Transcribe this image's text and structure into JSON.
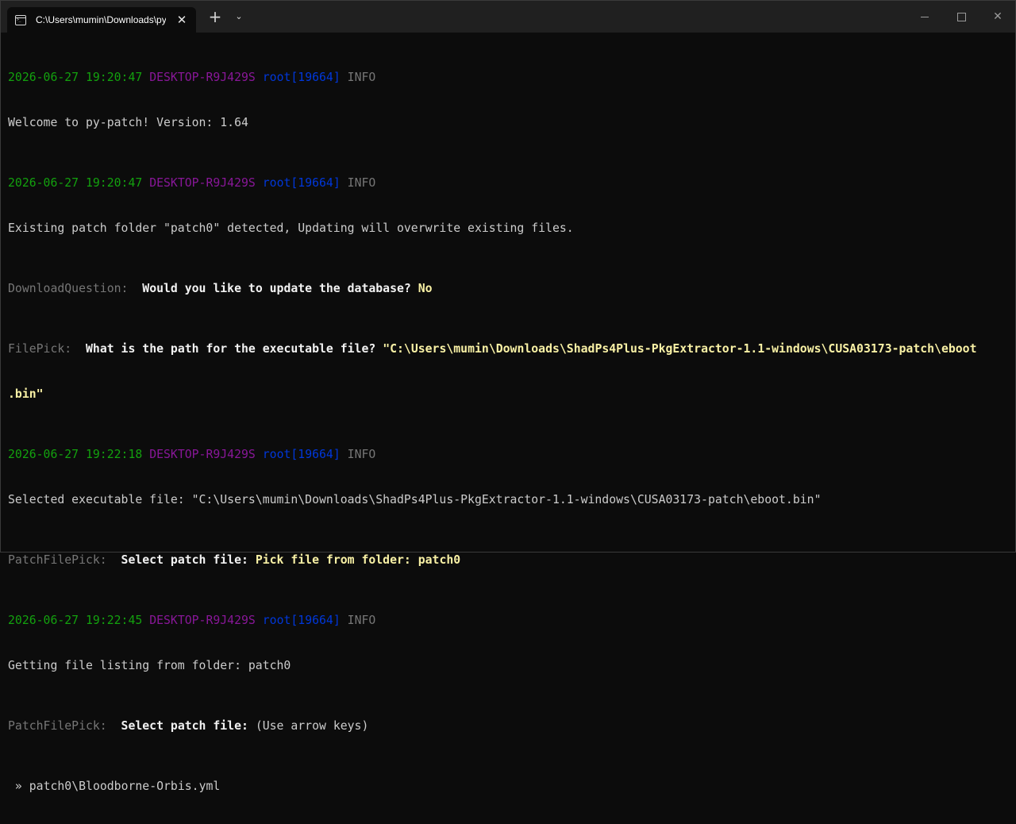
{
  "window": {
    "tab_title": "C:\\Users\\mumin\\Downloads\\py-patch.exe",
    "new_tab": "+",
    "dropdown": "⌄",
    "tab_close": "✕",
    "controls": {
      "close": "✕"
    }
  },
  "terminal": {
    "log1": {
      "date": "2026-06-27 19:20:47",
      "host": "DESKTOP-R9J429S",
      "user": "root[19664]",
      "level": "INFO"
    },
    "msg_welcome": "Welcome to py-patch! Version: 1.64",
    "log2": {
      "date": "2026-06-27 19:20:47",
      "host": "DESKTOP-R9J429S",
      "user": "root[19664]",
      "level": "INFO"
    },
    "msg_existing": "Existing patch folder \"patch0\" detected, Updating will overwrite existing files.",
    "q_download": {
      "tag": "DownloadQuestion:",
      "question": "Would you like to update the database?",
      "answer": "No"
    },
    "q_filepick": {
      "tag": "FilePick:",
      "question": "What is the path for the executable file?",
      "answer_line1": "\"C:\\Users\\mumin\\Downloads\\ShadPs4Plus-PkgExtractor-1.1-windows\\CUSA03173-patch\\eboot",
      "answer_line2": ".bin\""
    },
    "log3": {
      "date": "2026-06-27 19:22:18",
      "host": "DESKTOP-R9J429S",
      "user": "root[19664]",
      "level": "INFO"
    },
    "msg_selected": "Selected executable file: \"C:\\Users\\mumin\\Downloads\\ShadPs4Plus-PkgExtractor-1.1-windows\\CUSA03173-patch\\eboot.bin\"",
    "q_patchpick1": {
      "tag": "PatchFilePick:",
      "question": "Select patch file:",
      "answer": "Pick file from folder: patch0"
    },
    "log4": {
      "date": "2026-06-27 19:22:45",
      "host": "DESKTOP-R9J429S",
      "user": "root[19664]",
      "level": "INFO"
    },
    "msg_listing": "Getting file listing from folder: patch0",
    "q_patchpick2": {
      "tag": "PatchFilePick:",
      "question": "Select patch file:",
      "hint": "(Use arrow keys)"
    },
    "option_pointer": "»",
    "option_text": "patch0\\Bloodborne-Orbis.yml"
  },
  "colors": {
    "date": "#13a10e",
    "host": "#881798",
    "user": "#0037da",
    "level": "#767676",
    "answer": "#f9f1a5",
    "background": "#0c0c0c"
  }
}
